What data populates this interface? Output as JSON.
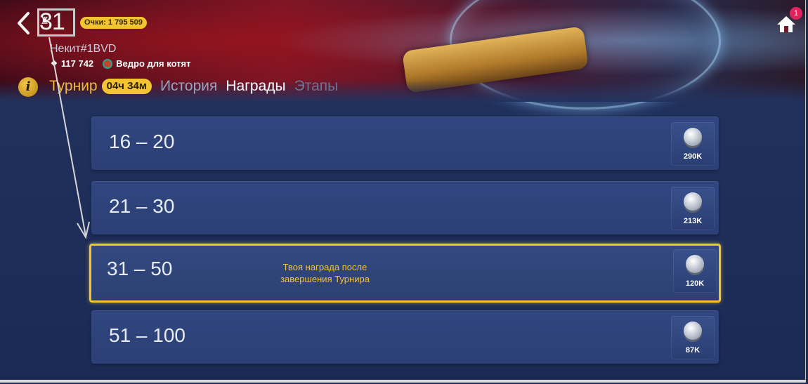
{
  "header": {
    "rank": "31",
    "score_label": "Очки: 1 795 509",
    "player_name": "Некит#1BVD",
    "power": "117 742",
    "clan_name": "Ведро для котят",
    "notification_count": "1"
  },
  "tabs": [
    {
      "label": "Турнир",
      "timer": "04ч 34м"
    },
    {
      "label": "История"
    },
    {
      "label": "Награды"
    },
    {
      "label": "Этапы"
    }
  ],
  "rewards": [
    {
      "range": "16 – 20",
      "amount": "290K"
    },
    {
      "range": "21 – 30",
      "amount": "213K"
    },
    {
      "range": "31 – 50",
      "amount": "120K",
      "note": "Твоя награда после завершения Турнира"
    },
    {
      "range": "51 – 100",
      "amount": "87K"
    }
  ],
  "colors": {
    "accent": "#f2c430",
    "badge": "#e0245b",
    "row_bg": "#2c3f76"
  },
  "icons": [
    "back-icon",
    "cup-icon",
    "gem-icon",
    "clan-icon",
    "info-icon",
    "home-icon",
    "coin-icon"
  ]
}
